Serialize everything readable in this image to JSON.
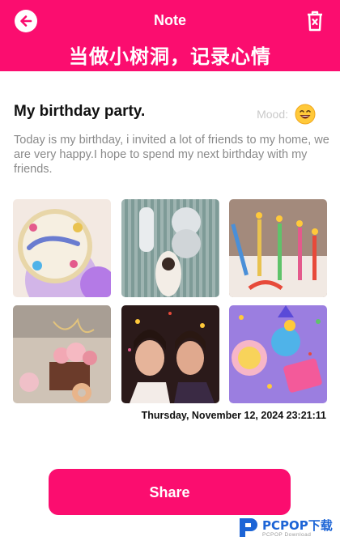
{
  "header": {
    "title": "Note",
    "back_icon": "arrow-left-icon",
    "delete_icon": "trash-icon",
    "background": "#fb0d6f"
  },
  "banner": {
    "text": "当做小树洞，记录心情"
  },
  "note": {
    "title": "My birthday party.",
    "mood_label": "Mood:",
    "mood_icon": "grinning-face-icon",
    "body": "Today is my birthday, i invited a lot of friends to my home, we are very happy.I hope to spend my next birthday with my friends.",
    "photos": [
      {
        "name": "birthday-balloon-photo"
      },
      {
        "name": "number-18-balloons-photo"
      },
      {
        "name": "birthday-candles-photo"
      },
      {
        "name": "decorated-cake-photo"
      },
      {
        "name": "party-confetti-photo"
      },
      {
        "name": "party-table-photo"
      }
    ],
    "timestamp": "Thursday, November 12, 2024 23:21:11"
  },
  "actions": {
    "share_label": "Share"
  },
  "watermark": {
    "brand": "PCPOP下载",
    "subtitle": "PCPOP Download"
  }
}
